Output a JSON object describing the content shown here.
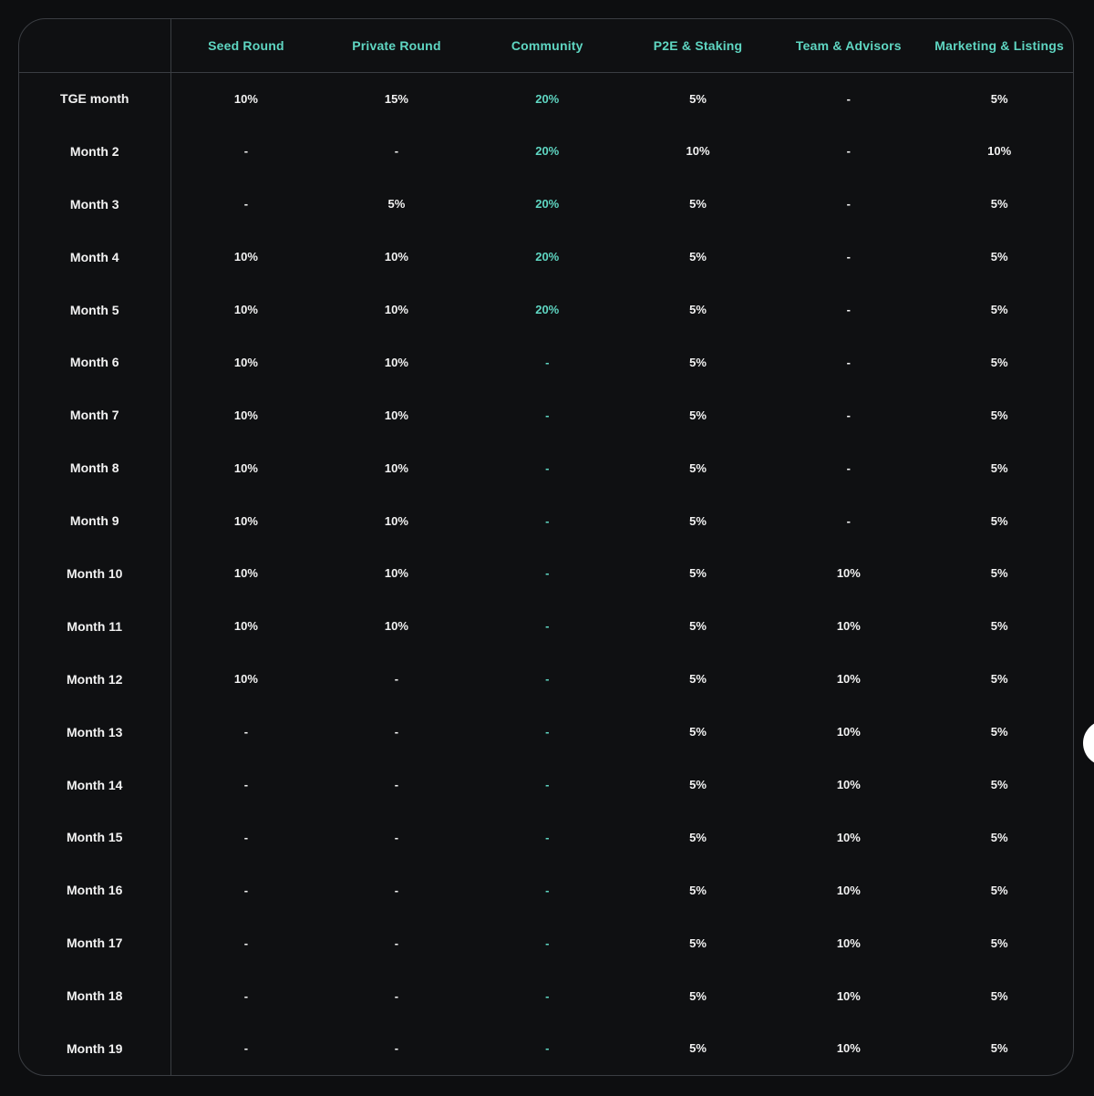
{
  "table": {
    "corner": "",
    "columns": [
      "Seed Round",
      "Private Round",
      "Community",
      "P2E & Staking",
      "Team & Advisors",
      "Marketing & Listings"
    ],
    "highlight_column_index": 2,
    "accent_color": "#5fd6c2",
    "rows": [
      {
        "label": "TGE month",
        "cells": [
          "10%",
          "15%",
          "20%",
          "5%",
          "-",
          "5%"
        ]
      },
      {
        "label": "Month 2",
        "cells": [
          "-",
          "-",
          "20%",
          "10%",
          "-",
          "10%"
        ]
      },
      {
        "label": "Month 3",
        "cells": [
          "-",
          "5%",
          "20%",
          "5%",
          "-",
          "5%"
        ]
      },
      {
        "label": "Month 4",
        "cells": [
          "10%",
          "10%",
          "20%",
          "5%",
          "-",
          "5%"
        ]
      },
      {
        "label": "Month 5",
        "cells": [
          "10%",
          "10%",
          "20%",
          "5%",
          "-",
          "5%"
        ]
      },
      {
        "label": "Month 6",
        "cells": [
          "10%",
          "10%",
          "-",
          "5%",
          "-",
          "5%"
        ]
      },
      {
        "label": "Month 7",
        "cells": [
          "10%",
          "10%",
          "-",
          "5%",
          "-",
          "5%"
        ]
      },
      {
        "label": "Month 8",
        "cells": [
          "10%",
          "10%",
          "-",
          "5%",
          "-",
          "5%"
        ]
      },
      {
        "label": "Month 9",
        "cells": [
          "10%",
          "10%",
          "-",
          "5%",
          "-",
          "5%"
        ]
      },
      {
        "label": "Month 10",
        "cells": [
          "10%",
          "10%",
          "-",
          "5%",
          "10%",
          "5%"
        ]
      },
      {
        "label": "Month 11",
        "cells": [
          "10%",
          "10%",
          "-",
          "5%",
          "10%",
          "5%"
        ]
      },
      {
        "label": "Month 12",
        "cells": [
          "10%",
          "-",
          "-",
          "5%",
          "10%",
          "5%"
        ]
      },
      {
        "label": "Month 13",
        "cells": [
          "-",
          "-",
          "-",
          "5%",
          "10%",
          "5%"
        ]
      },
      {
        "label": "Month 14",
        "cells": [
          "-",
          "-",
          "-",
          "5%",
          "10%",
          "5%"
        ]
      },
      {
        "label": "Month 15",
        "cells": [
          "-",
          "-",
          "-",
          "5%",
          "10%",
          "5%"
        ]
      },
      {
        "label": "Month 16",
        "cells": [
          "-",
          "-",
          "-",
          "5%",
          "10%",
          "5%"
        ]
      },
      {
        "label": "Month 17",
        "cells": [
          "-",
          "-",
          "-",
          "5%",
          "10%",
          "5%"
        ]
      },
      {
        "label": "Month 18",
        "cells": [
          "-",
          "-",
          "-",
          "5%",
          "10%",
          "5%"
        ]
      },
      {
        "label": "Month 19",
        "cells": [
          "-",
          "-",
          "-",
          "5%",
          "10%",
          "5%"
        ]
      }
    ]
  }
}
